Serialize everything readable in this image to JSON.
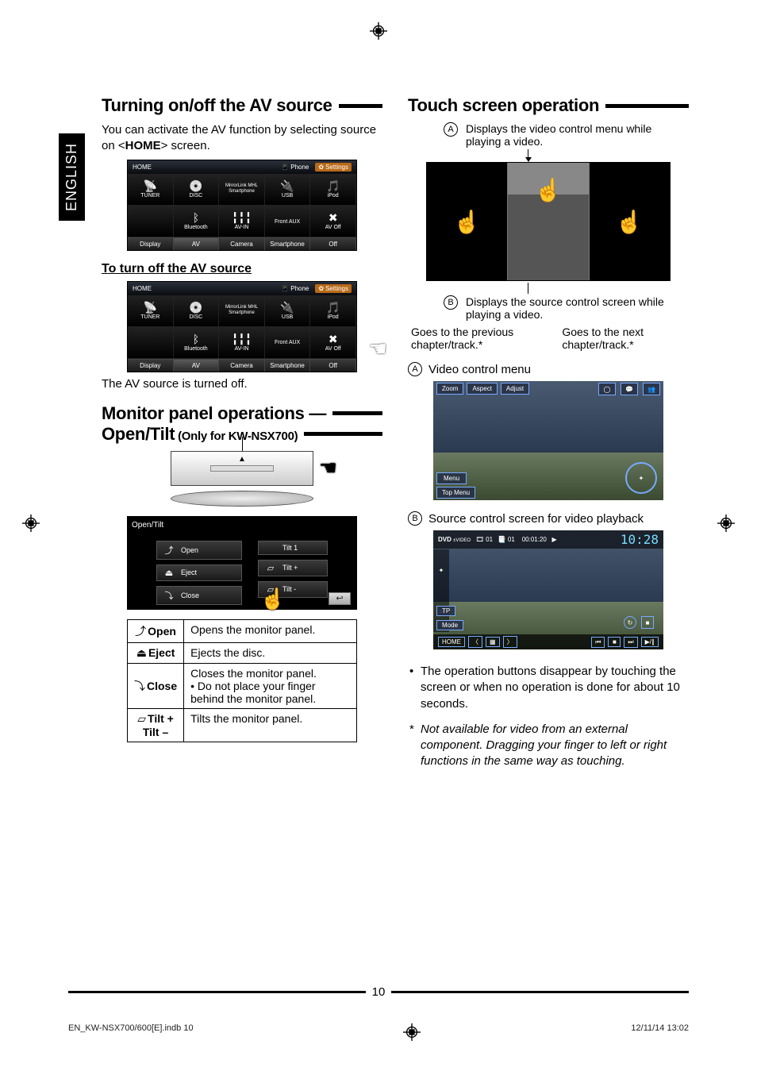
{
  "language_tab": "ENGLISH",
  "page_number": "10",
  "footer_left": "EN_KW-NSX700/600[E].indb   10",
  "footer_right": "12/11/14   13:02",
  "left": {
    "heading_av": "Turning on/off the AV source",
    "intro_pre": "You can activate the AV function by selecting source on <",
    "intro_bold": "HOME",
    "intro_post": "> screen.",
    "subhead_off": "To turn off the AV source",
    "note_off": "The AV source is turned off.",
    "heading_panel_main": "Monitor panel operations —",
    "heading_panel_sub_a": "Open/Tilt",
    "heading_panel_sub_b": " (Only for KW-NSX700)",
    "home_screen": {
      "title": "HOME",
      "phone": "Phone",
      "settings": "Settings",
      "cells_row1": [
        "TUNER",
        "DISC",
        "MirrorLink\n MHL\nSmartphone",
        "USB",
        "iPod"
      ],
      "cells_row2": [
        "",
        "Bluetooth",
        "AV-IN",
        "Front AUX",
        "AV Off"
      ],
      "tabs": [
        "Display",
        "AV",
        "Camera",
        "Smartphone",
        "Off"
      ]
    },
    "open_tilt_screen": {
      "title": "Open/Tilt",
      "left_buttons": [
        "Open",
        "Eject",
        "Close"
      ],
      "right_buttons": [
        "Tilt 1",
        "Tilt +",
        "Tilt -"
      ]
    },
    "panel_table": [
      {
        "key": "Open",
        "desc": "Opens the monitor panel."
      },
      {
        "key": "Eject",
        "desc": "Ejects the disc."
      },
      {
        "key": "Close",
        "desc": "Closes the monitor panel.\n•  Do not place your finger behind the monitor panel."
      },
      {
        "key": "Tilt +\nTilt –",
        "desc": "Tilts the monitor panel."
      }
    ]
  },
  "right": {
    "heading_touch": "Touch screen operation",
    "callout_a": "Displays the video control menu while playing a video.",
    "callout_b": "Displays the source control screen while playing a video.",
    "prev_label": "Goes to the previous chapter/track.*",
    "next_label": "Goes to the next chapter/track.*",
    "sub_a": "Video control menu",
    "video_menu": {
      "tabs": [
        "Zoom",
        "Aspect",
        "Adjust"
      ],
      "menu": "Menu",
      "top_menu": "Top Menu"
    },
    "sub_b": "Source control screen for video playback",
    "source_screen": {
      "source": "DVD",
      "sub": "±VIDEO",
      "title_no": "01",
      "chapter_no": "01",
      "time": "00:01:20",
      "clock": "10:28",
      "tp": "TP",
      "mode": "Mode",
      "home": "HOME"
    },
    "note_bullet": "The operation buttons disappear by touching the screen or when no operation is done for about 10 seconds.",
    "footnote": "Not available for video from an external component. Dragging your finger to left or right functions in the same way as touching."
  }
}
